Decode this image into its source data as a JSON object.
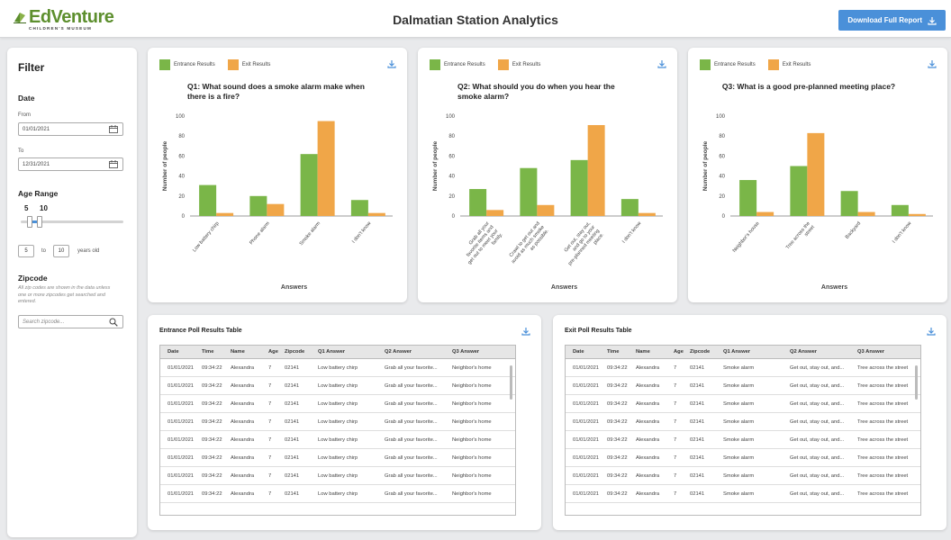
{
  "header": {
    "logo_main": "EdVenture",
    "logo_sub": "CHILDREN'S MUSEUM",
    "title": "Dalmatian Station Analytics",
    "download_label": "Download Full Report"
  },
  "filter": {
    "title": "Filter",
    "date_label": "Date",
    "from_label": "From",
    "from_value": "01/01/2021",
    "to_label": "To",
    "to_value": "12/31/2021",
    "age_label": "Age Range",
    "age_min": "5",
    "age_max": "10",
    "age_min_box": "5",
    "age_to": "to",
    "age_max_box": "10",
    "age_unit": "years old",
    "slider_range": [
      0.09,
      0.18
    ],
    "zip_label": "Zipcode",
    "zip_note": "All zip codes are shown in the data unless one or more zipcodes get searched and entered.",
    "zip_placeholder": "Search zipcode..."
  },
  "legend": {
    "entrance": "Entrance Results",
    "exit": "Exit Results"
  },
  "colors": {
    "entrance": "#7ab648",
    "exit": "#f0a648",
    "accent": "#4a90d9"
  },
  "chart_data": [
    {
      "type": "bar",
      "title": "Q1: What sound does a smoke alarm make when there is a fire?",
      "xlabel": "Answers",
      "ylabel": "Number of people",
      "ylim": [
        0,
        100
      ],
      "yticks": [
        "0",
        "20",
        "40",
        "60",
        "80",
        "100"
      ],
      "categories": [
        "Low battery chirp",
        "Phone alarm",
        "Smoke alarm",
        "I don't know"
      ],
      "series": [
        {
          "name": "Entrance Results",
          "values": [
            31,
            20,
            62,
            16
          ]
        },
        {
          "name": "Exit Results",
          "values": [
            3,
            12,
            95,
            3
          ]
        }
      ]
    },
    {
      "type": "bar",
      "title": "Q2: What should you do when you hear the smoke alarm?",
      "xlabel": "Answers",
      "ylabel": "Number of people",
      "ylim": [
        0,
        100
      ],
      "yticks": [
        "0",
        "20",
        "40",
        "60",
        "80",
        "100"
      ],
      "categories": [
        "Grab all your favorite items and get out to meet your family.",
        "Crawl to get out and avoid as much smoke as possible.",
        "Get out, stay out, and go to your pre-planned meeting place.",
        "I don't know"
      ],
      "series": [
        {
          "name": "Entrance Results",
          "values": [
            27,
            48,
            56,
            17
          ]
        },
        {
          "name": "Exit Results",
          "values": [
            6,
            11,
            91,
            3
          ]
        }
      ]
    },
    {
      "type": "bar",
      "title": "Q3: What is a good pre-planned meeting place?",
      "xlabel": "Answers",
      "ylabel": "Number of people",
      "ylim": [
        0,
        100
      ],
      "yticks": [
        "0",
        "20",
        "40",
        "60",
        "80",
        "100"
      ],
      "categories": [
        "Neighbor's house",
        "Tree across the street",
        "Backyard",
        "I don't know"
      ],
      "series": [
        {
          "name": "Entrance Results",
          "values": [
            36,
            50,
            25,
            11
          ]
        },
        {
          "name": "Exit Results",
          "values": [
            4,
            83,
            4,
            2
          ]
        }
      ]
    }
  ],
  "entrance_table": {
    "title": "Entrance Poll Results Table",
    "headers": [
      "Date",
      "Time",
      "Name",
      "Age",
      "Zipcode",
      "Q1 Answer",
      "Q2 Answer",
      "Q3 Answer"
    ],
    "rows": [
      [
        "01/01/2021",
        "09:34:22",
        "Alexandra",
        "7",
        "02141",
        "Low battery chirp",
        "Grab all your favorite...",
        "Neighbor's home"
      ],
      [
        "01/01/2021",
        "09:34:22",
        "Alexandra",
        "7",
        "02141",
        "Low battery chirp",
        "Grab all your favorite...",
        "Neighbor's home"
      ],
      [
        "01/01/2021",
        "09:34:22",
        "Alexandra",
        "7",
        "02141",
        "Low battery chirp",
        "Grab all your favorite...",
        "Neighbor's home"
      ],
      [
        "01/01/2021",
        "09:34:22",
        "Alexandra",
        "7",
        "02141",
        "Low battery chirp",
        "Grab all your favorite...",
        "Neighbor's home"
      ],
      [
        "01/01/2021",
        "09:34:22",
        "Alexandra",
        "7",
        "02141",
        "Low battery chirp",
        "Grab all your favorite...",
        "Neighbor's home"
      ],
      [
        "01/01/2021",
        "09:34:22",
        "Alexandra",
        "7",
        "02141",
        "Low battery chirp",
        "Grab all your favorite...",
        "Neighbor's home"
      ],
      [
        "01/01/2021",
        "09:34:22",
        "Alexandra",
        "7",
        "02141",
        "Low battery chirp",
        "Grab all your favorite...",
        "Neighbor's home"
      ],
      [
        "01/01/2021",
        "09:34:22",
        "Alexandra",
        "7",
        "02141",
        "Low battery chirp",
        "Grab all your favorite...",
        "Neighbor's home"
      ]
    ]
  },
  "exit_table": {
    "title": "Exit Poll Results Table",
    "headers": [
      "Date",
      "Time",
      "Name",
      "Age",
      "Zipcode",
      "Q1 Answer",
      "Q2 Answer",
      "Q3 Answer"
    ],
    "rows": [
      [
        "01/01/2021",
        "09:34:22",
        "Alexandra",
        "7",
        "02141",
        "Smoke alarm",
        "Get out, stay out, and...",
        "Tree across the street"
      ],
      [
        "01/01/2021",
        "09:34:22",
        "Alexandra",
        "7",
        "02141",
        "Smoke alarm",
        "Get out, stay out, and...",
        "Tree across the street"
      ],
      [
        "01/01/2021",
        "09:34:22",
        "Alexandra",
        "7",
        "02141",
        "Smoke alarm",
        "Get out, stay out, and...",
        "Tree across the street"
      ],
      [
        "01/01/2021",
        "09:34:22",
        "Alexandra",
        "7",
        "02141",
        "Smoke alarm",
        "Get out, stay out, and...",
        "Tree across the street"
      ],
      [
        "01/01/2021",
        "09:34:22",
        "Alexandra",
        "7",
        "02141",
        "Smoke alarm",
        "Get out, stay out, and...",
        "Tree across the street"
      ],
      [
        "01/01/2021",
        "09:34:22",
        "Alexandra",
        "7",
        "02141",
        "Smoke alarm",
        "Get out, stay out, and...",
        "Tree across the street"
      ],
      [
        "01/01/2021",
        "09:34:22",
        "Alexandra",
        "7",
        "02141",
        "Smoke alarm",
        "Get out, stay out, and...",
        "Tree across the street"
      ],
      [
        "01/01/2021",
        "09:34:22",
        "Alexandra",
        "7",
        "02141",
        "Smoke alarm",
        "Get out, stay out, and...",
        "Tree across the street"
      ]
    ]
  }
}
